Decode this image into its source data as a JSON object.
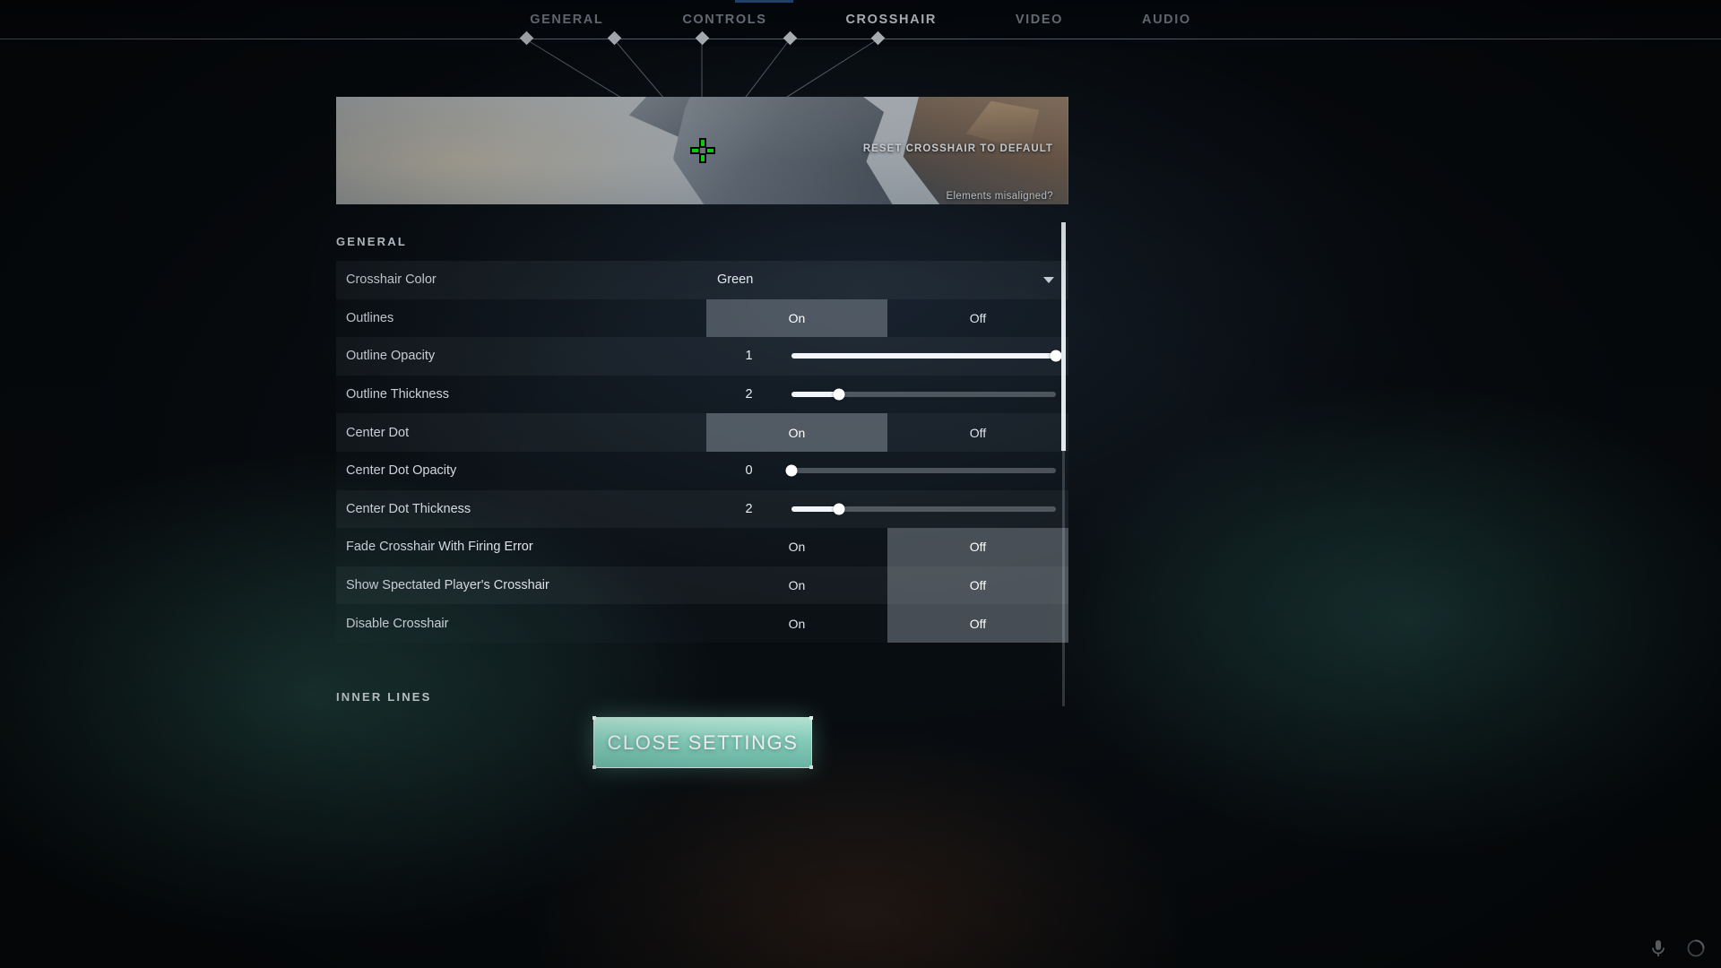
{
  "nav": {
    "tabs": [
      {
        "label": "GENERAL",
        "active": false
      },
      {
        "label": "CONTROLS",
        "active": false
      },
      {
        "label": "CROSSHAIR",
        "active": true
      },
      {
        "label": "VIDEO",
        "active": false
      },
      {
        "label": "AUDIO",
        "active": false
      }
    ]
  },
  "preview": {
    "reset_label": "RESET CROSSHAIR TO DEFAULT",
    "misaligned_label": "Elements misaligned?",
    "crosshair_color_hex": "#12f012",
    "outline_color_hex": "#000000"
  },
  "sections": {
    "general_header": "GENERAL",
    "inner_lines_header": "INNER LINES"
  },
  "settings": [
    {
      "label": "Crosshair Color",
      "type": "dropdown",
      "value": "Green"
    },
    {
      "label": "Outlines",
      "type": "toggle",
      "options": [
        "On",
        "Off"
      ],
      "selected": "On"
    },
    {
      "label": "Outline Opacity",
      "type": "slider",
      "value": "1",
      "percent": 100
    },
    {
      "label": "Outline Thickness",
      "type": "slider",
      "value": "2",
      "percent": 18
    },
    {
      "label": "Center Dot",
      "type": "toggle",
      "options": [
        "On",
        "Off"
      ],
      "selected": "On"
    },
    {
      "label": "Center Dot Opacity",
      "type": "slider",
      "value": "0",
      "percent": 0
    },
    {
      "label": "Center Dot Thickness",
      "type": "slider",
      "value": "2",
      "percent": 18
    },
    {
      "label": "Fade Crosshair With Firing Error",
      "type": "toggle",
      "options": [
        "On",
        "Off"
      ],
      "selected": "Off"
    },
    {
      "label": "Show Spectated Player's Crosshair",
      "type": "toggle",
      "options": [
        "On",
        "Off"
      ],
      "selected": "Off"
    },
    {
      "label": "Disable Crosshair",
      "type": "toggle",
      "options": [
        "On",
        "Off"
      ],
      "selected": "Off"
    }
  ],
  "footer": {
    "close_label": "CLOSE SETTINGS"
  },
  "tray": {
    "icons": [
      "microphone-icon",
      "loading-spinner-icon"
    ]
  },
  "colors": {
    "accent_mint": "#8fd9c6",
    "nav_active_blue": "#2f5f9e",
    "crosshair_green": "#12f012"
  }
}
